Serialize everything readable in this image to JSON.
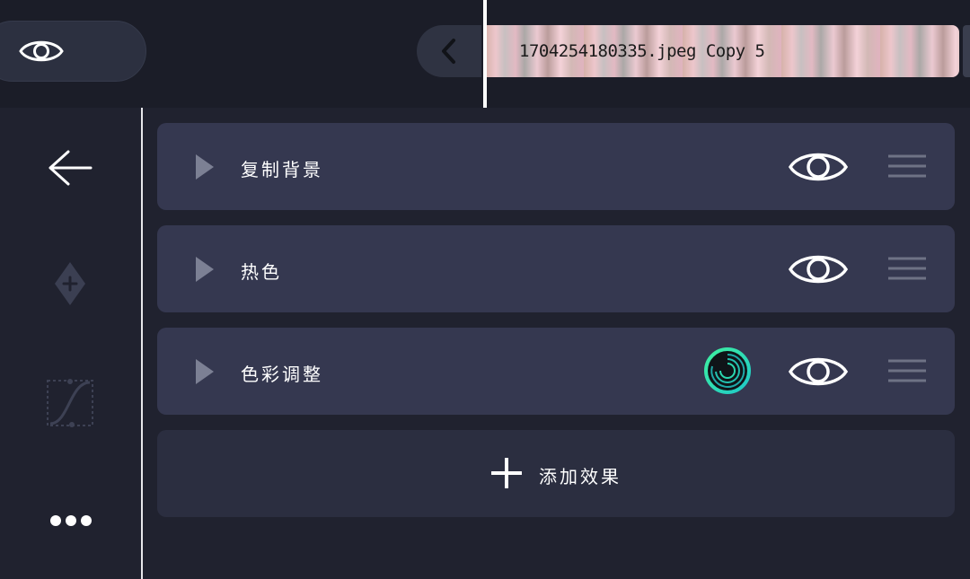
{
  "topbar": {
    "visibility_icon": "eye-icon",
    "back_icon": "chevron-left-icon",
    "clip": {
      "title": "1704254180335.jpeg Copy 5"
    }
  },
  "sidebar": {
    "back_icon": "arrow-left-icon",
    "keyframe_icon": "keyframe-add-icon",
    "curve_icon": "bezier-curve-icon",
    "more_icon": "more-horizontal-icon"
  },
  "effects": [
    {
      "label": "复制背景",
      "has_indicator": false
    },
    {
      "label": "热色",
      "has_indicator": false
    },
    {
      "label": "色彩调整",
      "has_indicator": true
    }
  ],
  "add_effect": {
    "label": "添加效果",
    "icon": "plus-icon"
  },
  "colors": {
    "accent": "#2de0b0",
    "card": "#353850",
    "background": "#20222f"
  }
}
